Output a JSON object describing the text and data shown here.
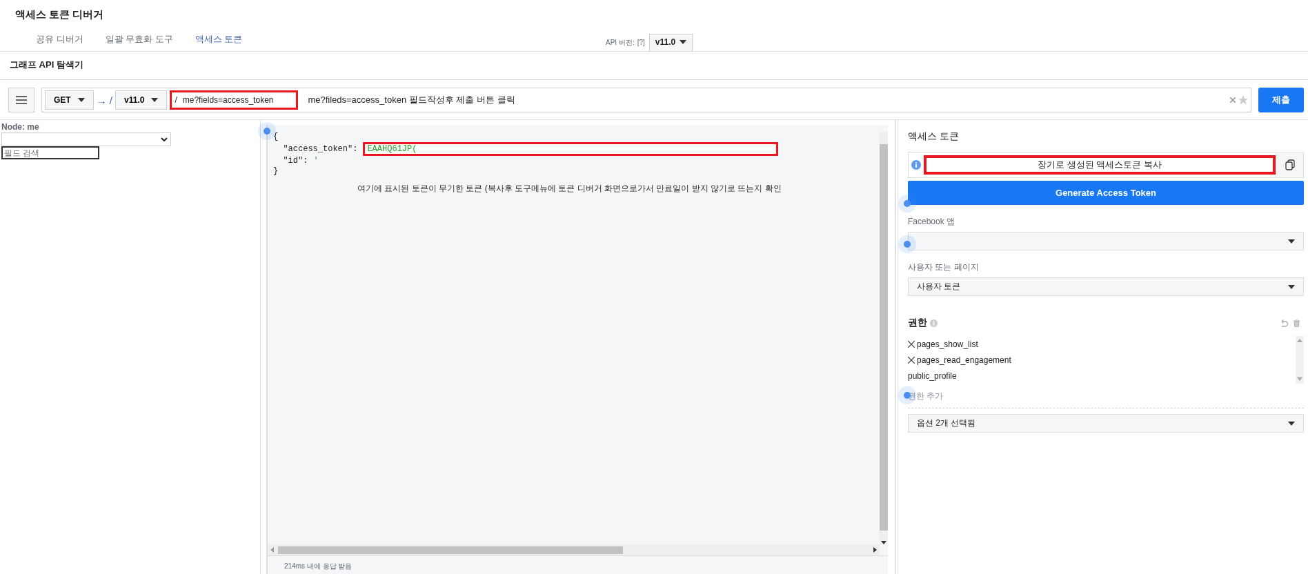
{
  "page_title": "액세스 토큰 디버거",
  "tabs": [
    {
      "label": "공유 디버거",
      "selected": false
    },
    {
      "label": "일괄 무효화 도구",
      "selected": false
    },
    {
      "label": "액세스 토큰",
      "selected": true
    }
  ],
  "api_version": {
    "label": "API 버전:",
    "help": "[?]",
    "value": "v11.0"
  },
  "explorer_title": "그래프 API 탐색기",
  "query": {
    "method": "GET",
    "arrow": "→ /",
    "version": "v11.0",
    "slash": "/",
    "path": "me?fields=access_token",
    "note": "me?fileds=access_token 필드작성후 제출 버튼 클릭",
    "submit": "제출"
  },
  "node_panel": {
    "label": "Node: me",
    "search_placeholder": "필드 검색"
  },
  "response": {
    "open_brace": "{",
    "fields": [
      {
        "key": "\"access_token\":",
        "value": "EAAHQ61JP("
      },
      {
        "key": "\"id\":",
        "value": "'"
      }
    ],
    "close_brace": "}",
    "note": "여기에 표시된 토큰이 무기한 토큰 (복사후 도구메뉴에 토큰 디버거 화면으로가서 만료일이 받지 않기로 뜨는지 확인",
    "status": "214ms 내에 응답 받음"
  },
  "token_panel": {
    "title": "액세스 토큰",
    "token_value": "장기로 생성된 액세스토큰 복사",
    "generate": "Generate Access Token",
    "app_label": "Facebook 앱",
    "user_label": "사용자 또는 페이지",
    "user_value": "사용자 토큰",
    "permissions_title": "권한",
    "permissions": [
      {
        "name": "pages_show_list",
        "removable": true
      },
      {
        "name": "pages_read_engagement",
        "removable": true
      },
      {
        "name": "public_profile",
        "removable": false
      }
    ],
    "add_permission": "권한 추가",
    "options_summary": "옵션 2개 선택됨"
  }
}
